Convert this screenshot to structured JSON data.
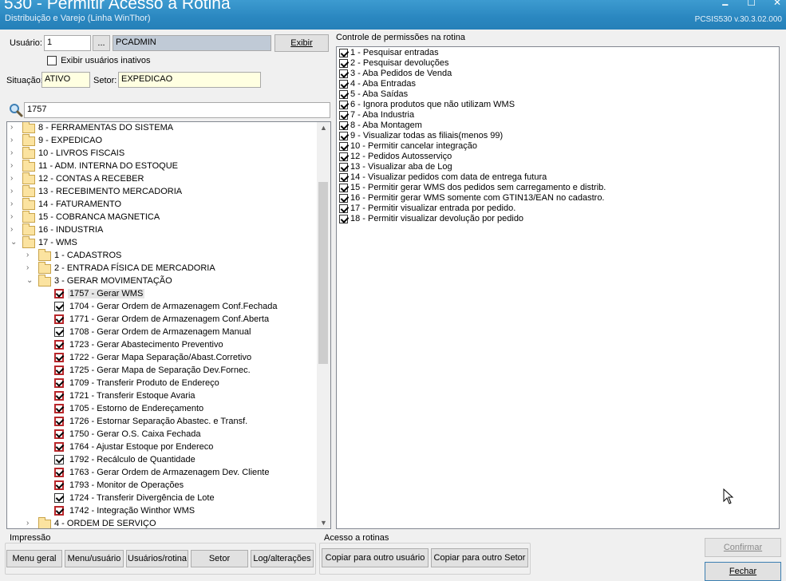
{
  "window": {
    "title": "530 - Permitir Acesso a Rotina",
    "subtitle": "Distribuição e Varejo (Linha WinThor)",
    "version": "PCSIS530  v.30.3.02.000",
    "min_glyph": "🗕",
    "max_glyph": "☐",
    "close_glyph": "✕"
  },
  "user": {
    "label": "Usuário:",
    "code": "1",
    "lookup_label": "...",
    "name": "PCADMIN",
    "show_button": "Exibir",
    "show_inactive_label": "Exibir usuários inativos",
    "show_inactive_checked": false,
    "situation_label": "Situação:",
    "situation_value": "ATIVO",
    "sector_label": "Setor:",
    "sector_value": "EXPEDICAO"
  },
  "search": {
    "value": "1757"
  },
  "tree": {
    "rows": [
      {
        "level": 0,
        "expander": "›",
        "type": "folder",
        "label": "8 - FERRAMENTAS DO SISTEMA"
      },
      {
        "level": 0,
        "expander": "›",
        "type": "folder",
        "label": "9 - EXPEDICAO"
      },
      {
        "level": 0,
        "expander": "›",
        "type": "folder",
        "label": "10 - LIVROS FISCAIS"
      },
      {
        "level": 0,
        "expander": "›",
        "type": "folder",
        "label": "11 - ADM. INTERNA DO ESTOQUE"
      },
      {
        "level": 0,
        "expander": "›",
        "type": "folder",
        "label": "12 - CONTAS A RECEBER"
      },
      {
        "level": 0,
        "expander": "›",
        "type": "folder",
        "label": "13 - RECEBIMENTO MERCADORIA"
      },
      {
        "level": 0,
        "expander": "›",
        "type": "folder",
        "label": "14 - FATURAMENTO"
      },
      {
        "level": 0,
        "expander": "›",
        "type": "folder",
        "label": "15 - COBRANCA MAGNETICA"
      },
      {
        "level": 0,
        "expander": "›",
        "type": "folder",
        "label": "16 - INDUSTRIA"
      },
      {
        "level": 0,
        "expander": "⌄",
        "type": "folder",
        "label": "17 - WMS"
      },
      {
        "level": 1,
        "expander": "›",
        "type": "folder",
        "label": "1 - CADASTROS"
      },
      {
        "level": 1,
        "expander": "›",
        "type": "folder",
        "label": "2 - ENTRADA FÍSICA DE MERCADORIA"
      },
      {
        "level": 1,
        "expander": "⌄",
        "type": "folder",
        "label": "3 - GERAR MOVIMENTAÇÃO"
      },
      {
        "level": 2,
        "type": "check",
        "red": true,
        "checked": true,
        "selected": true,
        "label": "1757 - Gerar WMS"
      },
      {
        "level": 2,
        "type": "check",
        "red": false,
        "checked": true,
        "label": "1704 - Gerar Ordem de Armazenagem Conf.Fechada"
      },
      {
        "level": 2,
        "type": "check",
        "red": true,
        "checked": true,
        "label": "1771 - Gerar Ordem de Armazenagem Conf.Aberta"
      },
      {
        "level": 2,
        "type": "check",
        "red": false,
        "checked": true,
        "label": "1708 - Gerar Ordem de Armazenagem Manual"
      },
      {
        "level": 2,
        "type": "check",
        "red": true,
        "checked": true,
        "label": "1723 - Gerar Abastecimento Preventivo"
      },
      {
        "level": 2,
        "type": "check",
        "red": true,
        "checked": true,
        "label": "1722 - Gerar Mapa Separação/Abast.Corretivo"
      },
      {
        "level": 2,
        "type": "check",
        "red": true,
        "checked": true,
        "label": "1725 - Gerar Mapa de Separação Dev.Fornec."
      },
      {
        "level": 2,
        "type": "check",
        "red": true,
        "checked": true,
        "label": "1709 - Transferir Produto de Endereço"
      },
      {
        "level": 2,
        "type": "check",
        "red": true,
        "checked": true,
        "label": "1721 - Transferir Estoque Avaria"
      },
      {
        "level": 2,
        "type": "check",
        "red": true,
        "checked": true,
        "label": "1705 - Estorno de Endereçamento"
      },
      {
        "level": 2,
        "type": "check",
        "red": true,
        "checked": true,
        "label": "1726 - Estornar Separação Abastec. e Transf."
      },
      {
        "level": 2,
        "type": "check",
        "red": true,
        "checked": true,
        "label": "1750 - Gerar O.S. Caixa Fechada"
      },
      {
        "level": 2,
        "type": "check",
        "red": true,
        "checked": true,
        "label": "1764 - Ajustar Estoque por Endereco"
      },
      {
        "level": 2,
        "type": "check",
        "red": false,
        "checked": true,
        "label": "1792 - Recálculo de Quantidade"
      },
      {
        "level": 2,
        "type": "check",
        "red": true,
        "checked": true,
        "label": "1763 - Gerar Ordem de Armazenagem Dev. Cliente"
      },
      {
        "level": 2,
        "type": "check",
        "red": true,
        "checked": true,
        "label": "1793 - Monitor de Operações"
      },
      {
        "level": 2,
        "type": "check",
        "red": false,
        "checked": true,
        "label": "1724 - Transferir Divergência de Lote"
      },
      {
        "level": 2,
        "type": "check",
        "red": true,
        "checked": true,
        "label": "1742 - Integração Winthor WMS"
      },
      {
        "level": 1,
        "expander": "›",
        "type": "folder",
        "label": "4 - ORDEM DE SERVIÇO"
      }
    ]
  },
  "permissions": {
    "title": "Controle de permissões na rotina",
    "items": [
      {
        "label": "1 - Pesquisar entradas",
        "checked": true
      },
      {
        "label": "2 - Pesquisar devoluções",
        "checked": true
      },
      {
        "label": "3 - Aba Pedidos de Venda",
        "checked": true
      },
      {
        "label": "4 - Aba Entradas",
        "checked": true
      },
      {
        "label": "5 - Aba Saídas",
        "checked": true
      },
      {
        "label": "6 - Ignora produtos que não utilizam WMS",
        "checked": true
      },
      {
        "label": "7 - Aba Industria",
        "checked": true
      },
      {
        "label": "8 - Aba Montagem",
        "checked": true
      },
      {
        "label": "9 - Visualizar todas as filiais(menos 99)",
        "checked": true
      },
      {
        "label": "10 - Permitir cancelar integração",
        "checked": true
      },
      {
        "label": "12 - Pedidos Autosserviço",
        "checked": true
      },
      {
        "label": "13 - Visualizar aba de Log",
        "checked": true
      },
      {
        "label": "14 - Visualizar pedidos com data de entrega futura",
        "checked": true
      },
      {
        "label": "15 - Permitir gerar WMS dos pedidos sem carregamento e distrib.",
        "checked": true
      },
      {
        "label": "16 - Permitir gerar WMS somente com GTIN13/EAN no cadastro.",
        "checked": true
      },
      {
        "label": "17 - Permitir visualizar entrada por pedido.",
        "checked": true
      },
      {
        "label": "18 - Permitir visualizar devolução por pedido",
        "checked": true
      }
    ]
  },
  "printing": {
    "title": "Impressão",
    "buttons": [
      "Menu geral",
      "Menu/usuário",
      "Usuários/rotina",
      "Setor",
      "Log/alterações"
    ]
  },
  "access": {
    "title": "Acesso a rotinas",
    "copy_user": "Copiar para outro usuário",
    "copy_sector": "Copiar para outro Setor"
  },
  "footer": {
    "confirm": "Confirmar",
    "close": "Fechar"
  }
}
